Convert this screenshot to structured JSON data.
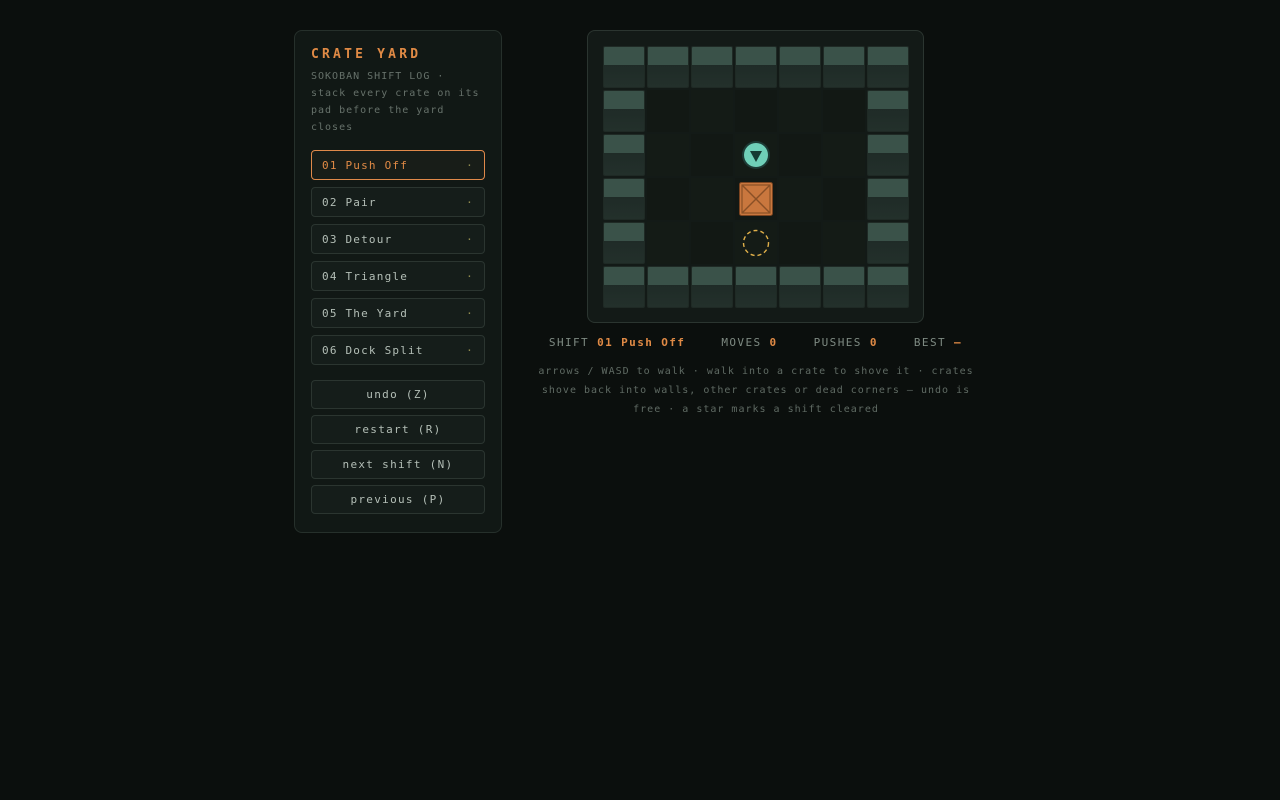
{
  "game": {
    "title": "CRATE YARD",
    "subtitle": "SOKOBAN SHIFT LOG · stack every crate on its pad before the yard closes"
  },
  "levels": [
    {
      "label": "01 Push Off",
      "marker": "·",
      "active": true
    },
    {
      "label": "02 Pair",
      "marker": "·",
      "active": false
    },
    {
      "label": "03 Detour",
      "marker": "·",
      "active": false
    },
    {
      "label": "04 Triangle",
      "marker": "·",
      "active": false
    },
    {
      "label": "05 The Yard",
      "marker": "·",
      "active": false
    },
    {
      "label": "06 Dock Split",
      "marker": "·",
      "active": false
    }
  ],
  "actions": {
    "undo": "undo (Z)",
    "restart": "restart (R)",
    "next": "next shift (N)",
    "previous": "previous (P)"
  },
  "status": {
    "shift_label": "SHIFT",
    "shift_value": "01 Push Off",
    "moves_label": "MOVES",
    "moves_value": "0",
    "pushes_label": "PUSHES",
    "pushes_value": "0",
    "best_label": "BEST",
    "best_value": "—"
  },
  "help_text": "arrows / WASD to walk · walk into a crate to shove it · crates shove back into walls, other crates or dead corners — undo is free · a star marks a shift cleared",
  "board": {
    "rows": [
      "#######",
      "#.....#",
      "#..@..#",
      "#..$..#",
      "#..o..#",
      "#######"
    ],
    "player_facing": "down"
  },
  "colors": {
    "accent": "#e08a45",
    "crate": "#c9773e",
    "player": "#6fcfb8",
    "pad": "#e0b04a",
    "wall": "#3a5249"
  },
  "icons": {
    "player": "player-down-arrow-icon",
    "crate": "crate-icon",
    "pad": "goal-pad-icon"
  }
}
